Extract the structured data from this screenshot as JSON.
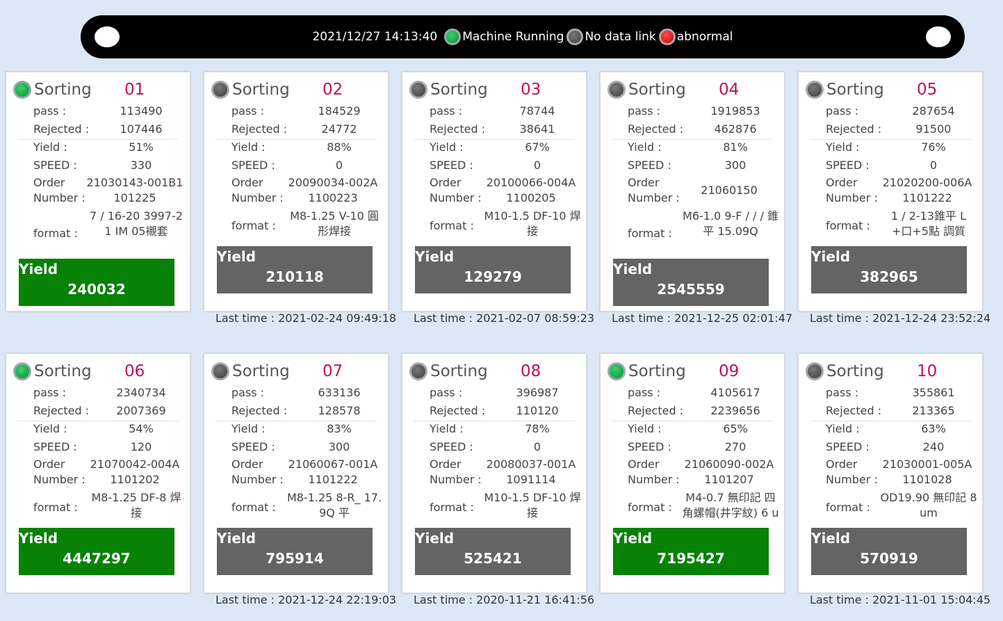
{
  "header": {
    "datetime": "2021/12/27 14:13:40",
    "legend": [
      {
        "status": "green",
        "label": "Machine Running"
      },
      {
        "status": "gray",
        "label": "No data link"
      },
      {
        "status": "red",
        "label": "abnormal"
      }
    ]
  },
  "labels": {
    "title": "Sorting",
    "pass": "pass :",
    "rejected": "Rejected :",
    "yield": "Yield :",
    "speed": "SPEED :",
    "order1": "Order",
    "order2": "Number :",
    "format": "format :",
    "yield_box": "Yield",
    "last_time": "Last time : "
  },
  "colors": {
    "running": "#078207",
    "nolink": "#646464",
    "number": "#c0105a"
  },
  "machines": [
    {
      "num": "01",
      "status": "green",
      "pass": "113490",
      "rejected": "107446",
      "yield": "51%",
      "speed": "330",
      "order": "21030143-001B1",
      "number": "101225",
      "format": "7 / 16-20 3997-2 1 IM 05襯套",
      "total": "240032",
      "last_time": ""
    },
    {
      "num": "02",
      "status": "gray",
      "pass": "184529",
      "rejected": "24772",
      "yield": "88%",
      "speed": "0",
      "order": "20090034-002A",
      "number": "1100223",
      "format": "M8-1.25 V-10 圓形焊接",
      "total": "210118",
      "last_time": "2021-02-24 09:49:18"
    },
    {
      "num": "03",
      "status": "gray",
      "pass": "78744",
      "rejected": "38641",
      "yield": "67%",
      "speed": "0",
      "order": "20100066-004A",
      "number": "1100205",
      "format": "M10-1.5 DF-10 焊接",
      "total": "129279",
      "last_time": "2021-02-07 08:59:23"
    },
    {
      "num": "04",
      "status": "gray",
      "pass": "1919853",
      "rejected": "462876",
      "yield": "81%",
      "speed": "300",
      "order": "",
      "number": "21060150",
      "format": "M6-1.0 9-F / / / 錐平 15.09Q",
      "total": "2545559",
      "last_time": "2021-12-25 02:01:47"
    },
    {
      "num": "05",
      "status": "gray",
      "pass": "287654",
      "rejected": "91500",
      "yield": "76%",
      "speed": "0",
      "order": "21020200-006A",
      "number": "1101222",
      "format": "1 / 2-13錐平 L +口+5點 調質",
      "total": "382965",
      "last_time": "2021-12-24 23:52:24"
    },
    {
      "num": "06",
      "status": "green",
      "pass": "2340734",
      "rejected": "2007369",
      "yield": "54%",
      "speed": "120",
      "order": "21070042-004A",
      "number": "1101202",
      "format": "M8-1.25 DF-8 焊接",
      "total": "4447297",
      "last_time": ""
    },
    {
      "num": "07",
      "status": "gray",
      "pass": "633136",
      "rejected": "128578",
      "yield": "83%",
      "speed": "300",
      "order": "21060067-001A",
      "number": "1101222",
      "format": "M8-1.25 8-R_ 17.9Q 平",
      "total": "795914",
      "last_time": "2021-12-24 22:19:03"
    },
    {
      "num": "08",
      "status": "gray",
      "pass": "396987",
      "rejected": "110120",
      "yield": "78%",
      "speed": "0",
      "order": "20080037-001A",
      "number": "1091114",
      "format": "M10-1.5 DF-10 焊接",
      "total": "525421",
      "last_time": "2020-11-21 16:41:56"
    },
    {
      "num": "09",
      "status": "green",
      "pass": "4105617",
      "rejected": "2239656",
      "yield": "65%",
      "speed": "270",
      "order": "21060090-002A",
      "number": "1101207",
      "format": "M4-0.7 無印記 四角螺帽(井字紋) 6 u",
      "total": "7195427",
      "last_time": ""
    },
    {
      "num": "10",
      "status": "gray",
      "pass": "355861",
      "rejected": "213365",
      "yield": "63%",
      "speed": "240",
      "order": "21030001-005A",
      "number": "1101028",
      "format": "OD19.90 無印記 8um",
      "total": "570919",
      "last_time": "2021-11-01 15:04:45"
    }
  ]
}
